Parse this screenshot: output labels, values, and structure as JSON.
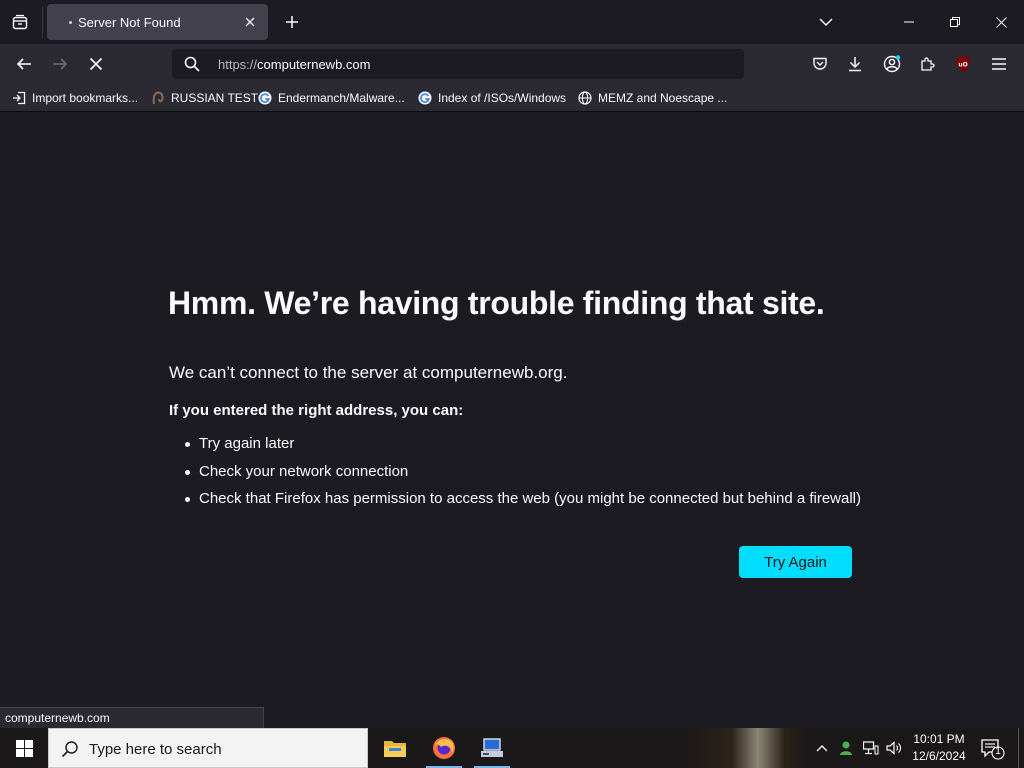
{
  "tab": {
    "title": "Server Not Found"
  },
  "urlbar": {
    "scheme": "https://",
    "host": "computernewb.com"
  },
  "bookmarks": [
    {
      "label": "Import bookmarks...",
      "icon": "import-icon"
    },
    {
      "label": "RUSSIAN TEST",
      "icon": "site-favicon"
    },
    {
      "label": "Endermanch/Malware...",
      "icon": "google-g-icon"
    },
    {
      "label": "Index of /ISOs/Windows",
      "icon": "google-g-icon"
    },
    {
      "label": "MEMZ and Noescape ...",
      "icon": "globe-icon"
    }
  ],
  "error": {
    "title": "Hmm. We’re having trouble finding that site.",
    "description": "We can’t connect to the server at computernewb.org.",
    "subtitle": "If you entered the right address, you can:",
    "items": [
      "Try again later",
      "Check your network connection",
      "Check that Firefox has permission to access the web (you might be connected but behind a firewall)"
    ],
    "button": "Try Again"
  },
  "status": {
    "text": "computernewb.com"
  },
  "taskbar": {
    "search_placeholder": "Type here to search",
    "time": "10:01 PM",
    "date": "12/6/2024",
    "notification_count": "1",
    "apps": [
      "file-explorer-icon",
      "firefox-icon",
      "network-app-icon"
    ]
  },
  "colors": {
    "accent": "#00ddff",
    "page_bg": "#1c1b22",
    "toolbar_bg": "#2b2a33",
    "tab_active": "#42414d"
  }
}
